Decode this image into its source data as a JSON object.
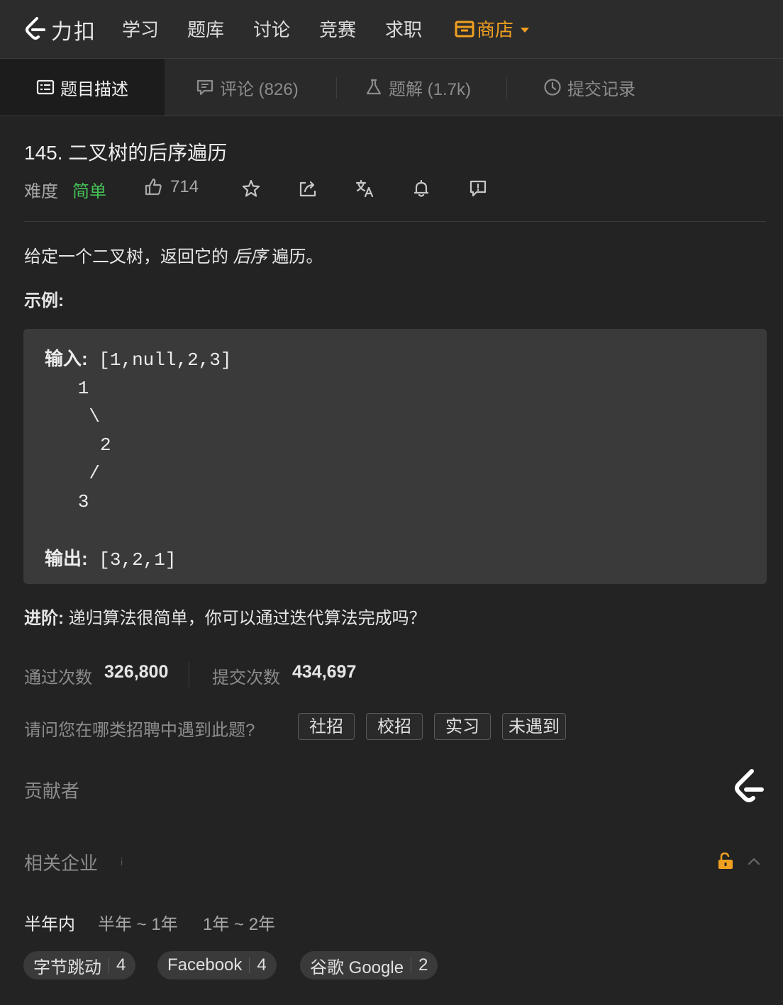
{
  "nav": {
    "brand": "力扣",
    "items": [
      "学习",
      "题库",
      "讨论",
      "竞赛",
      "求职"
    ],
    "shop": "商店",
    "accent": "#f0a020"
  },
  "tabs": {
    "description": "题目描述",
    "comments": "评论 (826)",
    "solutions": "题解 (1.7k)",
    "submissions": "提交记录"
  },
  "problem": {
    "title": "145. 二叉树的后序遍历",
    "difficulty_label": "难度",
    "difficulty": "简单",
    "difficulty_color": "#44c256",
    "likes": "714",
    "desc_prefix": "给定一个二叉树，返回它的 ",
    "desc_em": "后序",
    "desc_suffix": " 遍历。",
    "example_heading": "示例:",
    "example": {
      "input_label": "输入:",
      "input_value": " [1,null,2,3]",
      "tree_lines": [
        "   1",
        "    \\",
        "     2",
        "    /",
        "   3"
      ],
      "output_label": "输出:",
      "output_value": " [3,2,1]"
    },
    "advanced_label": "进阶:",
    "advanced_text": " 递归算法很简单，你可以通过迭代算法完成吗？"
  },
  "stats": {
    "accepted_label": "通过次数",
    "accepted_value": "326,800",
    "submitted_label": "提交次数",
    "submitted_value": "434,697"
  },
  "hiring": {
    "question": "请问您在哪类招聘中遇到此题?",
    "options": [
      "社招",
      "校招",
      "实习",
      "未遇到"
    ]
  },
  "contributors": {
    "heading": "贡献者"
  },
  "companies": {
    "heading": "相关企业",
    "periods": [
      "半年内",
      "半年 ~ 1年",
      "1年 ~ 2年"
    ],
    "list": [
      {
        "name": "字节跳动",
        "count": "4"
      },
      {
        "name": "Facebook",
        "count": "4"
      },
      {
        "name": "谷歌 Google",
        "count": "2"
      }
    ]
  },
  "icons": [
    "leetcode-logo-icon",
    "shop-icon",
    "caret-down-icon",
    "description-icon",
    "comment-icon",
    "flask-icon",
    "clock-icon",
    "thumbs-up-icon",
    "star-icon",
    "share-icon",
    "translate-icon",
    "bell-icon",
    "feedback-icon",
    "unlock-icon",
    "chevron-up-icon"
  ]
}
